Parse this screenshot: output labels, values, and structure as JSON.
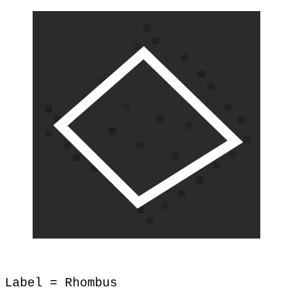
{
  "caption": {
    "text": "Label = Rhombus"
  },
  "image": {
    "shape": "rhombus",
    "background_color": "#2b2b2b",
    "stroke_color": "#ffffff"
  }
}
